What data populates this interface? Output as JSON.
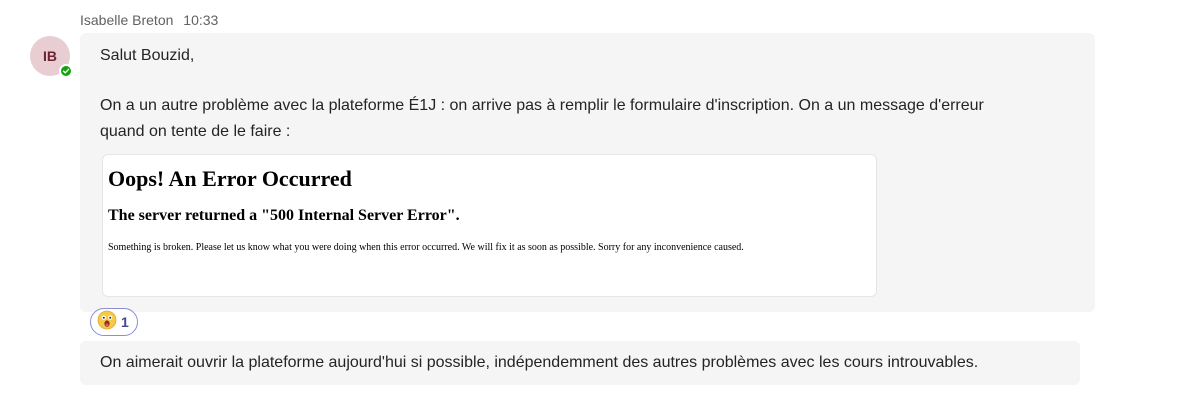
{
  "message": {
    "author": "Isabelle Breton",
    "time": "10:33",
    "avatar_initials": "IB",
    "presence": "available",
    "greeting": "Salut Bouzid,",
    "body_line1": "On a un autre problème avec la plateforme É1J : on arrive pas à remplir le formulaire d'inscription. On a un message d'erreur",
    "body_line2": "quand on tente de le faire :",
    "error_embed": {
      "title": "Oops! An Error Occurred",
      "subtitle": "The server returned a \"500 Internal Server Error\".",
      "text": "Something is broken. Please let us know what you were doing when this error occurred. We will fix it as soon as possible. Sorry for any inconvenience caused."
    },
    "reaction": {
      "emoji": "surprised-face",
      "count": "1"
    }
  },
  "followup": {
    "text": "On aimerait ouvrir la plateforme aujourd'hui si possible, indépendemment des autres problèmes avec les cours introuvables."
  },
  "colors": {
    "bubble_bg": "#f5f5f5",
    "presence": "#13a10e",
    "reaction_border": "#8a8fd6",
    "reaction_count": "#444791",
    "avatar_bg": "#e8cdd2"
  }
}
